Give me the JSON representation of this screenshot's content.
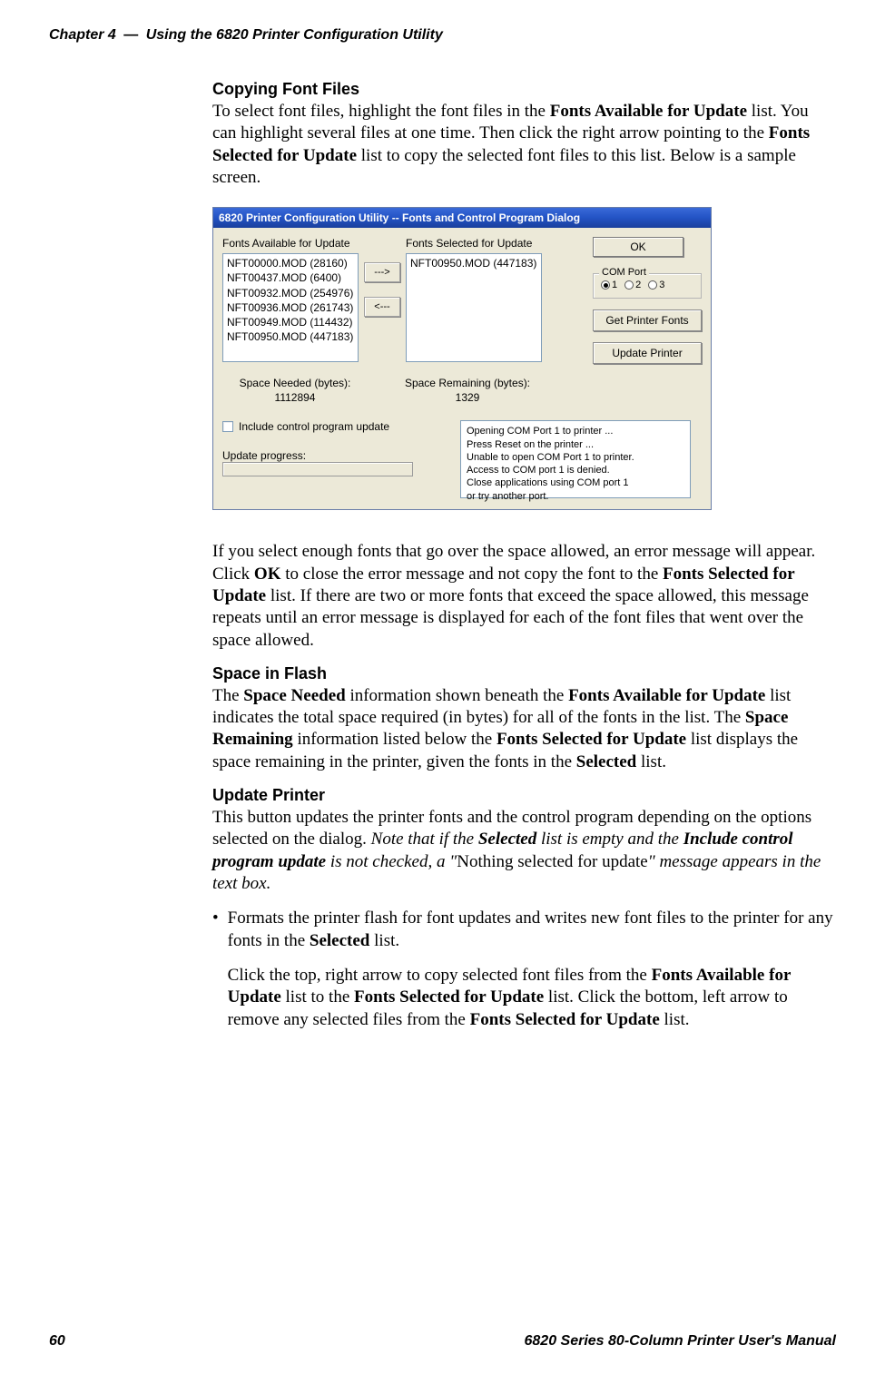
{
  "running_head": {
    "left": "Chapter 4",
    "sep": "—",
    "right": "Using the 6820 Printer Configuration Utility"
  },
  "sections": {
    "copying": {
      "title": "Copying Font Files",
      "p_pre": "To select font files, highlight the font files in the ",
      "b1": "Fonts Available for Update",
      "p_mid1": " list. You can highlight several files at one time. Then click the right arrow pointing to the ",
      "b2": "Fonts Selected for Update",
      "p_end": " list to copy the selected font files to this list. Below is a sample screen."
    },
    "after_shot": {
      "p_pre": "If you select enough fonts that go over the space allowed, an error message will appear. Click ",
      "b1": "OK",
      "p_mid1": " to close the error message and not copy the font to the ",
      "b2": "Fonts Selected for Update",
      "p_end": " list. If there are two or more fonts that exceed the space allowed, this message repeats until an error message is displayed for each of the font files that went over the space allowed."
    },
    "space": {
      "title": "Space in Flash",
      "p_pre": "The ",
      "b1": "Space Needed",
      "p_mid1": " information shown beneath the ",
      "b2": "Fonts Available for Update",
      "p_mid2": " list indicates the total space required (in bytes) for all of the fonts in the list. The ",
      "b3": "Space Remaining",
      "p_mid3": " information listed below the ",
      "b4": "Fonts Selected for Update",
      "p_mid4": " list displays the space remaining in the printer, given the fonts in the ",
      "b5": "Selected",
      "p_end": " list."
    },
    "update": {
      "title": "Update Printer",
      "p_pre": "This button updates the printer fonts and the control program depending on the options selected on the dialog. ",
      "i1": "Note that if the ",
      "bi1": "Selected",
      "i2": " list is empty and the ",
      "bi2": "Include control program update",
      "i3": " is not checked, a \"",
      "plain": "Nothing selected for update",
      "i4": "\" message appears in the text box.",
      "bullet_pre": "Formats the printer flash for font updates and writes new font files to the printer for any fonts in the ",
      "bullet_b": "Selected",
      "bullet_end": " list.",
      "sub_pre": "Click the top, right arrow to copy selected font files from the ",
      "sub_b1": "Fonts Available for Update",
      "sub_mid1": " list to the ",
      "sub_b2": "Fonts Selected for Update",
      "sub_mid2": " list. Click the bottom, left arrow to remove any selected files from the ",
      "sub_b3": "Fonts Selected for Update",
      "sub_end": " list."
    }
  },
  "dialog": {
    "title": "6820 Printer Configuration Utility -- Fonts and Control Program Dialog",
    "avail_label": "Fonts Available for Update",
    "sel_label": "Fonts Selected for Update",
    "avail_items": [
      "NFT00000.MOD (28160)",
      "NFT00437.MOD (6400)",
      "NFT00932.MOD (254976)",
      "NFT00936.MOD (261743)",
      "NFT00949.MOD (114432)",
      "NFT00950.MOD (447183)"
    ],
    "sel_items": [
      "NFT00950.MOD (447183)"
    ],
    "arrow_right": "--->",
    "arrow_left": "<---",
    "ok": "OK",
    "com_legend": "COM Port",
    "com_opts": [
      "1",
      "2",
      "3"
    ],
    "com_selected": 0,
    "get_fonts": "Get Printer Fonts",
    "update_printer": "Update Printer",
    "space_needed_label": "Space Needed (bytes):",
    "space_needed_value": "1112894",
    "space_remaining_label": "Space Remaining (bytes):",
    "space_remaining_value": "1329",
    "include_label": "Include control program update",
    "progress_label": "Update progress:",
    "status_lines": [
      "Opening COM Port 1 to printer ...",
      "  Press Reset on the printer ...",
      "Unable to open COM Port 1 to printer.",
      "  Access to COM port 1 is denied.",
      "  Close applications using COM port 1",
      "    or try another port."
    ]
  },
  "footer": {
    "page": "60",
    "manual": "6820 Series 80-Column Printer User's Manual"
  }
}
